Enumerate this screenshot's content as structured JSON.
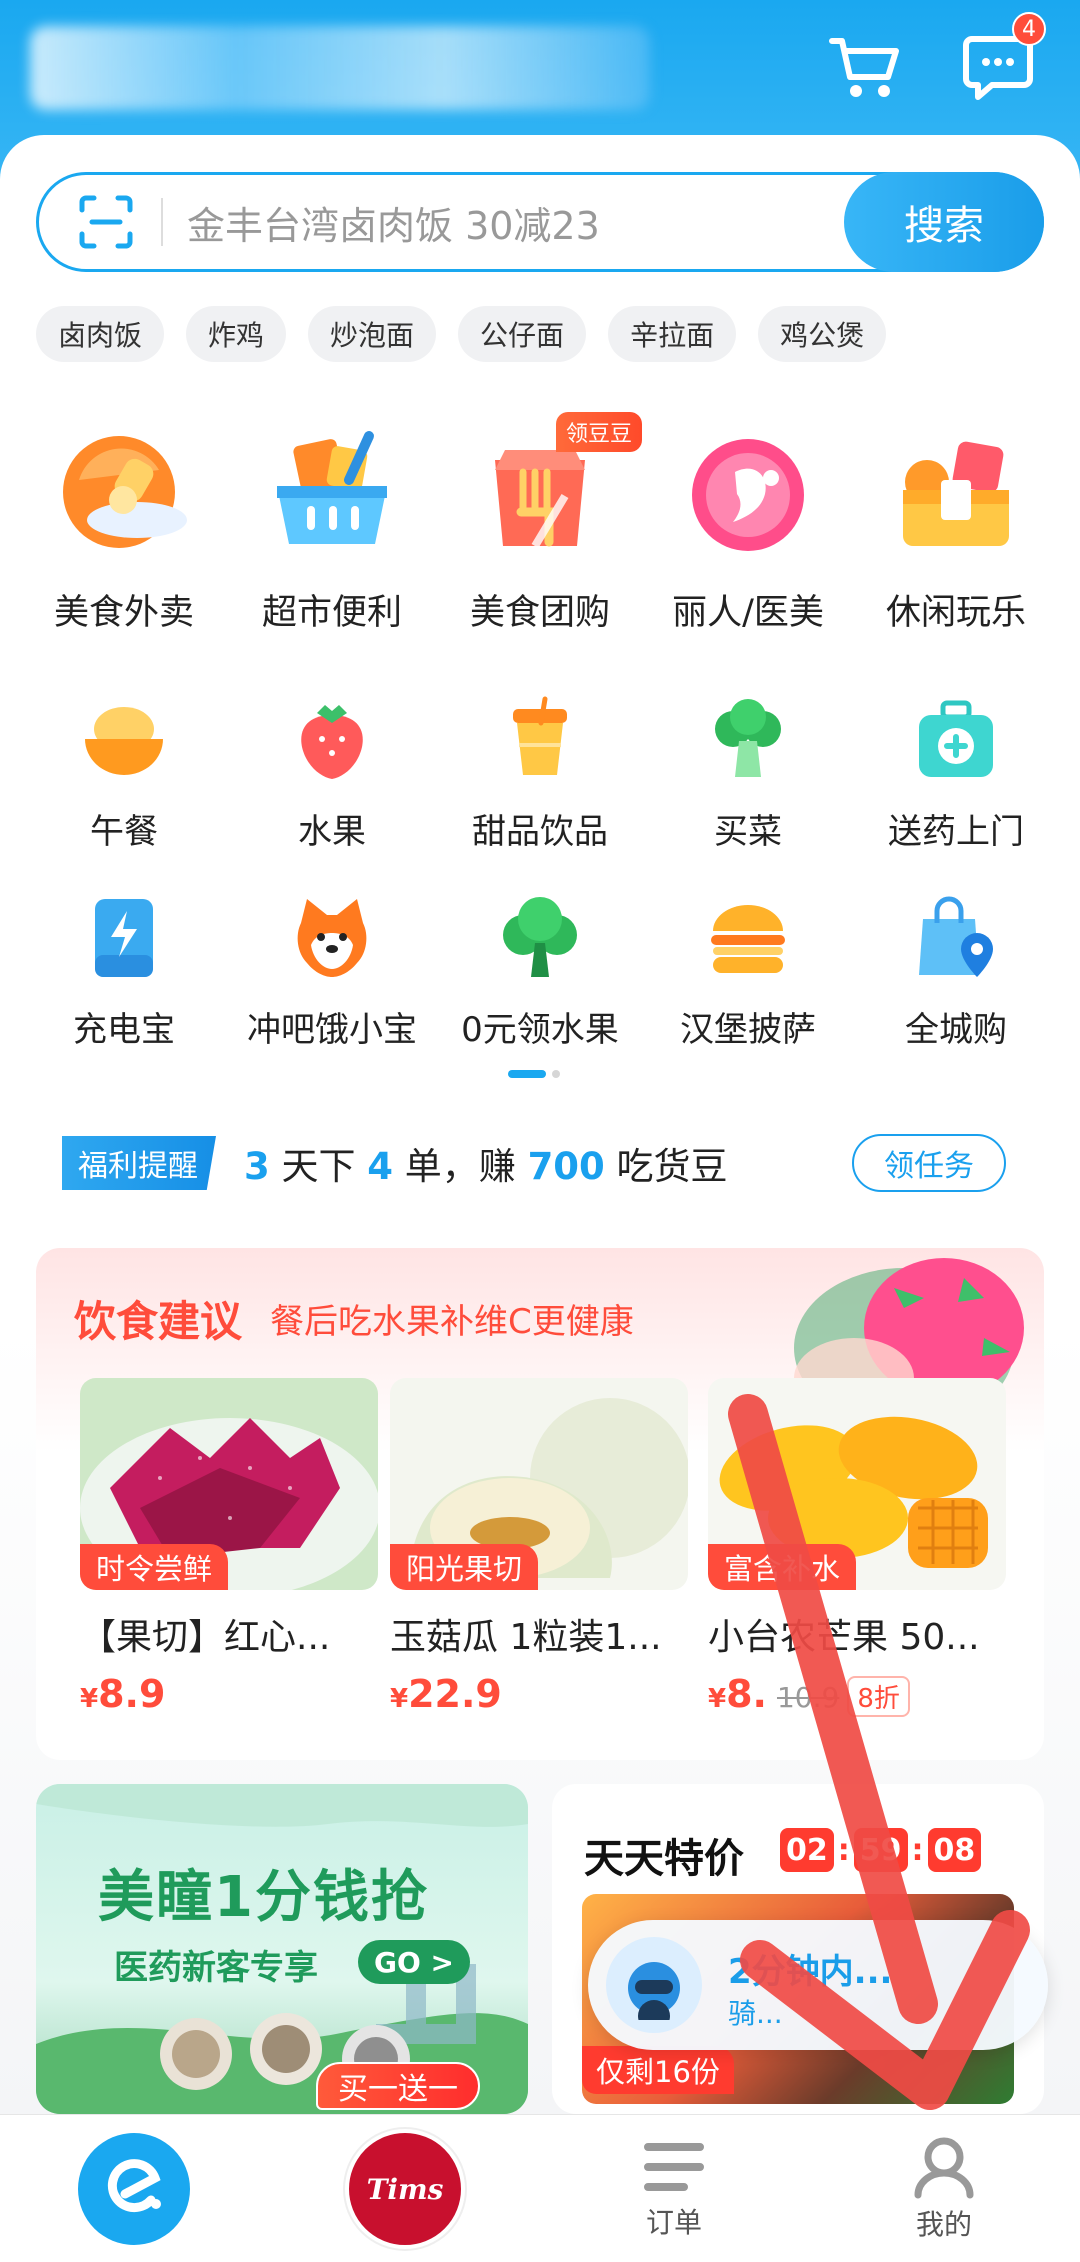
{
  "header": {
    "message_badge": "4"
  },
  "search": {
    "placeholder": "金丰台湾卤肉饭 30减23",
    "button": "搜索"
  },
  "hot_tags": [
    "卤肉饭",
    "炸鸡",
    "炒泡面",
    "公仔面",
    "辛拉面",
    "鸡公煲"
  ],
  "categories_main": [
    {
      "label": "美食外卖",
      "icon": "food-delivery-icon"
    },
    {
      "label": "超市便利",
      "icon": "basket-icon"
    },
    {
      "label": "美食团购",
      "icon": "group-buy-icon",
      "tag": "领豆豆"
    },
    {
      "label": "丽人/医美",
      "icon": "beauty-icon"
    },
    {
      "label": "休闲玩乐",
      "icon": "leisure-icon"
    }
  ],
  "categories_row2": [
    {
      "label": "午餐",
      "icon": "rice-bowl-icon"
    },
    {
      "label": "水果",
      "icon": "strawberry-icon"
    },
    {
      "label": "甜品饮品",
      "icon": "drink-cup-icon"
    },
    {
      "label": "买菜",
      "icon": "broccoli-icon"
    },
    {
      "label": "送药上门",
      "icon": "medicine-kit-icon"
    }
  ],
  "categories_row3": [
    {
      "label": "充电宝",
      "icon": "power-bank-icon"
    },
    {
      "label": "冲吧饿小宝",
      "icon": "shiba-icon"
    },
    {
      "label": "0元领水果",
      "icon": "tree-icon"
    },
    {
      "label": "汉堡披萨",
      "icon": "burger-icon"
    },
    {
      "label": "全城购",
      "icon": "shopping-bag-location-icon"
    }
  ],
  "welfare": {
    "tag": "福利提醒",
    "days": "3",
    "t1": " 天下 ",
    "orders": "4",
    "t2": " 单，赚 ",
    "beans": "700",
    "t3": " 吃货豆",
    "button": "领任务"
  },
  "diet": {
    "title": "饮食建议",
    "subtitle": "餐后吃水果补维C更健康",
    "products": [
      {
        "badge": "时令尝鲜",
        "name": "【果切】红心...",
        "price": "8.9",
        "currency": "¥"
      },
      {
        "badge": "阳光果切",
        "name": "玉菇瓜 1粒装1...",
        "price": "22.9",
        "currency": "¥"
      },
      {
        "badge": "富含补水",
        "name": "小台农芒果 50...",
        "price": "8.",
        "currency": "¥",
        "old_price": "10.9",
        "discount": "8折"
      }
    ]
  },
  "promo": {
    "title": "美瞳1分钱抢",
    "subtitle": "医药新客专享",
    "go": "GO >"
  },
  "daily": {
    "title": "天天特价",
    "timer": [
      "02",
      "59",
      "08"
    ],
    "left_badge": "仅剩16份",
    "rider_title": "2分钟内...",
    "rider_sub": "骑..."
  },
  "tabbar": {
    "home_icon": "eleme-logo-icon",
    "tims_label": "Tims",
    "buy_one": "买一送一",
    "orders": "订单",
    "mine": "我的"
  },
  "colors": {
    "brand": "#1aa8f0",
    "accent_red": "#ff4c3b",
    "arrow": "#f04b45"
  }
}
